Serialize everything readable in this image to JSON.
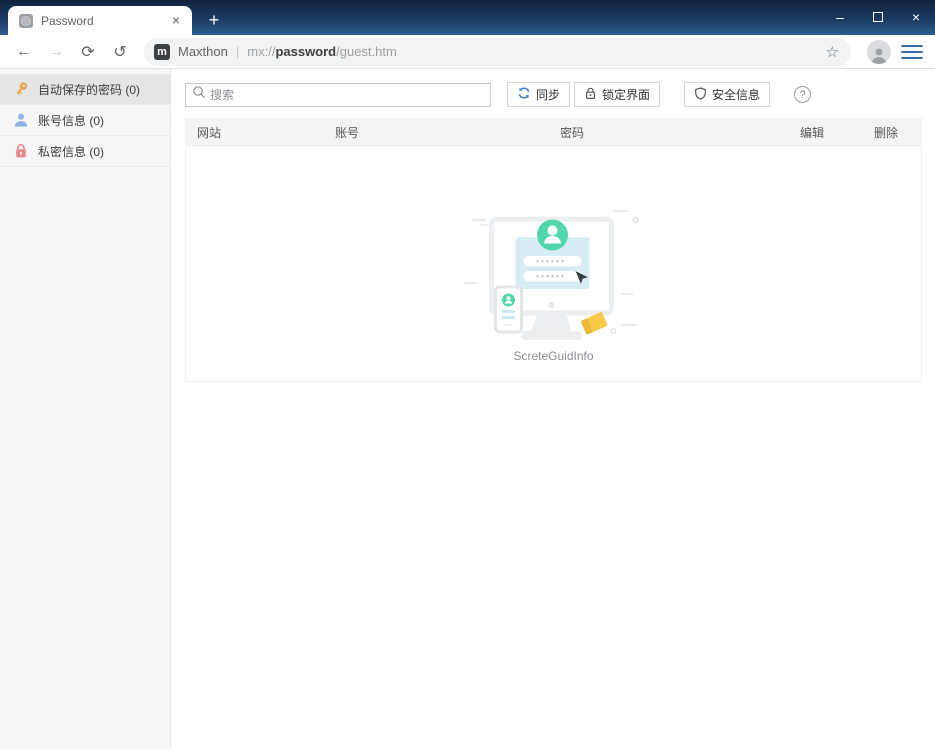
{
  "window": {
    "tab_title": "Password",
    "icons": {
      "close_tab": "×",
      "new_tab": "+",
      "minimize": "–",
      "close_window": "×"
    }
  },
  "toolbar": {
    "icons": {
      "back": "←",
      "forward": "→",
      "reload": "⟳",
      "undo": "↺",
      "star": "☆"
    },
    "address": {
      "logo_letter": "m",
      "brand": "Maxthon",
      "separator": "|",
      "url_scheme": "mx://",
      "url_host": "password",
      "url_path": "/guest.htm"
    }
  },
  "sidebar": {
    "items": [
      {
        "label": "自动保存的密码 (0)",
        "icon": "key-icon",
        "selected": true
      },
      {
        "label": "账号信息 (0)",
        "icon": "user-icon",
        "selected": false
      },
      {
        "label": "私密信息 (0)",
        "icon": "lock-icon",
        "selected": false
      }
    ]
  },
  "main": {
    "search_placeholder": "搜索",
    "buttons": {
      "sync": "同步",
      "lock": "锁定界面",
      "security": "安全信息",
      "help": "?"
    },
    "table": {
      "headers": [
        "网站",
        "账号",
        "密码",
        "编辑",
        "删除"
      ]
    },
    "empty_state": {
      "caption": "ScreteGuidInfo"
    }
  },
  "colors": {
    "titlebar_top": "#10233f",
    "titlebar_bottom": "#2d5d8f",
    "sidebar_selected": "#e5e5e5",
    "accent_sync": "#3a7fd5",
    "key_gold": "#dfa43e",
    "user_blue": "#8cb3e8",
    "lock_red": "#e98585",
    "illustration_green": "#53d6ae",
    "illustration_blue": "#d6edf6",
    "sticky_yellow": "#f8c94b"
  }
}
